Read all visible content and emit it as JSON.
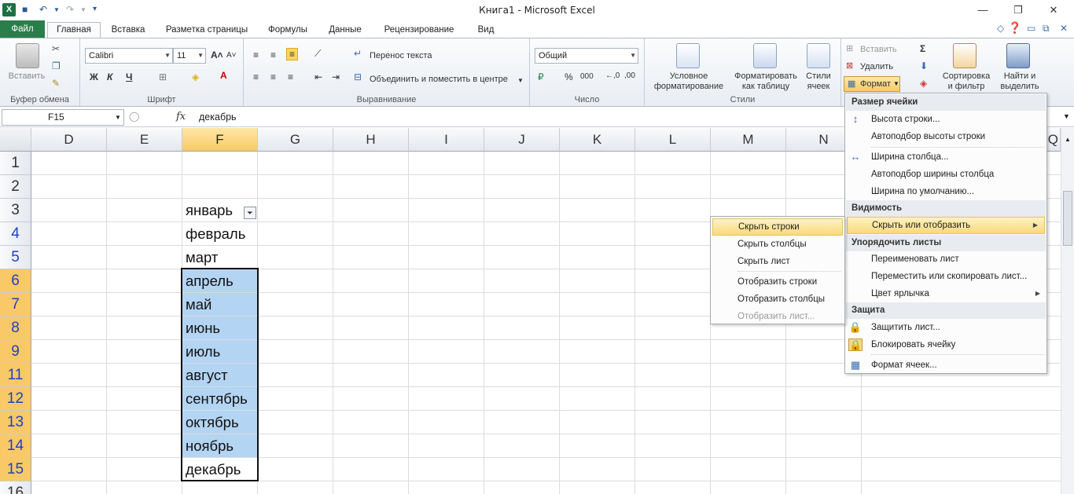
{
  "window": {
    "title": "Книга1  -  Microsoft Excel"
  },
  "tabs": [
    "Файл",
    "Главная",
    "Вставка",
    "Разметка страницы",
    "Формулы",
    "Данные",
    "Рецензирование",
    "Вид"
  ],
  "ribbon": {
    "clipboard": {
      "label": "Буфер обмена",
      "paste": "Вставить"
    },
    "font": {
      "label": "Шрифт",
      "name": "Calibri",
      "size": "11",
      "bold": "Ж",
      "italic": "К",
      "underline": "Ч"
    },
    "alignment": {
      "label": "Выравнивание",
      "wrap": "Перенос текста",
      "merge": "Объединить и поместить в центре"
    },
    "number": {
      "label": "Число",
      "format": "Общий",
      "percent": "%",
      "thousands": "000"
    },
    "styles": {
      "label": "Стили",
      "cond1": "Условное",
      "cond2": "форматирование",
      "astable1": "Форматировать",
      "astable2": "как таблицу",
      "styles1": "Стили",
      "styles2": "ячеек"
    },
    "cells": {
      "insert": "Вставить",
      "delete": "Удалить",
      "format": "Формат"
    },
    "editing": {
      "sort1": "Сортировка",
      "sort2": "и фильтр",
      "find1": "Найти и",
      "find2": "выделить"
    }
  },
  "formula_bar": {
    "name_box": "F15",
    "fx": "fx",
    "value": "декабрь"
  },
  "columns": [
    "D",
    "E",
    "F",
    "G",
    "H",
    "I",
    "J",
    "K",
    "L",
    "M",
    "N",
    "Q"
  ],
  "rows": [
    "1",
    "2",
    "3",
    "4",
    "5",
    "6",
    "7",
    "8",
    "9",
    "11",
    "12",
    "13",
    "14",
    "15",
    "16"
  ],
  "cells": {
    "F3": "январь",
    "F4": "февраль",
    "F5": "март",
    "F6": "апрель",
    "F7": "май",
    "F8": "июнь",
    "F9": "июль",
    "F11": "август",
    "F12": "сентябрь",
    "F13": "октябрь",
    "F14": "ноябрь",
    "F15": "декабрь"
  },
  "format_menu": {
    "cell_size": "Размер ячейки",
    "row_height": "Высота строки...",
    "autofit_row": "Автоподбор высоты строки",
    "col_width": "Ширина столбца...",
    "autofit_col": "Автоподбор ширины столбца",
    "default_width": "Ширина по умолчанию...",
    "visibility": "Видимость",
    "hide_unhide": "Скрыть или отобразить",
    "organize": "Упорядочить листы",
    "rename": "Переименовать лист",
    "move_copy": "Переместить или скопировать лист...",
    "tab_color": "Цвет ярлычка",
    "protection": "Защита",
    "protect_sheet": "Защитить лист...",
    "lock_cell": "Блокировать ячейку",
    "format_cells": "Формат ячеек..."
  },
  "hide_submenu": {
    "hide_rows": "Скрыть строки",
    "hide_cols": "Скрыть столбцы",
    "hide_sheet": "Скрыть лист",
    "unhide_rows": "Отобразить строки",
    "unhide_cols": "Отобразить столбцы",
    "unhide_sheet": "Отобразить лист..."
  }
}
